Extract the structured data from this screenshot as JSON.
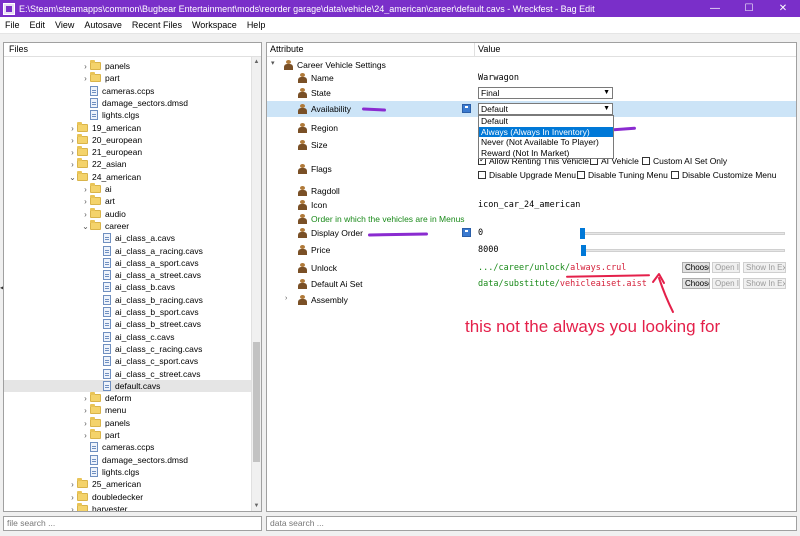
{
  "window": {
    "title": "E:\\Steam\\steamapps\\common\\Bugbear Entertainment\\mods\\reorder garage\\data\\vehicle\\24_american\\career\\default.cavs - Wreckfest - Bag Edit",
    "minimize": "—",
    "maximize": "☐",
    "close": "✕"
  },
  "menu": [
    "File",
    "Edit",
    "View",
    "Autosave",
    "Recent Files",
    "Workspace",
    "Help"
  ],
  "files_panel": {
    "header": "Files",
    "tree": [
      {
        "label": "panels",
        "type": "folder",
        "depth": 1,
        "expandable": true
      },
      {
        "label": "part",
        "type": "folder",
        "depth": 1,
        "expandable": true
      },
      {
        "label": "cameras.ccps",
        "type": "file",
        "depth": 1
      },
      {
        "label": "damage_sectors.dmsd",
        "type": "file",
        "depth": 1
      },
      {
        "label": "lights.clgs",
        "type": "file",
        "depth": 1
      },
      {
        "label": "19_american",
        "type": "folder",
        "depth": 0,
        "expandable": true
      },
      {
        "label": "20_european",
        "type": "folder",
        "depth": 0,
        "expandable": true
      },
      {
        "label": "21_european",
        "type": "folder",
        "depth": 0,
        "expandable": true
      },
      {
        "label": "22_asian",
        "type": "folder",
        "depth": 0,
        "expandable": true
      },
      {
        "label": "24_american",
        "type": "folder",
        "depth": 0,
        "expanded": true
      },
      {
        "label": "ai",
        "type": "folder",
        "depth": 1,
        "expandable": true
      },
      {
        "label": "art",
        "type": "folder",
        "depth": 1,
        "expandable": true
      },
      {
        "label": "audio",
        "type": "folder",
        "depth": 1,
        "expandable": true
      },
      {
        "label": "career",
        "type": "folder",
        "depth": 1,
        "expanded": true
      },
      {
        "label": "ai_class_a.cavs",
        "type": "file",
        "depth": 2
      },
      {
        "label": "ai_class_a_racing.cavs",
        "type": "file",
        "depth": 2
      },
      {
        "label": "ai_class_a_sport.cavs",
        "type": "file",
        "depth": 2
      },
      {
        "label": "ai_class_a_street.cavs",
        "type": "file",
        "depth": 2
      },
      {
        "label": "ai_class_b.cavs",
        "type": "file",
        "depth": 2
      },
      {
        "label": "ai_class_b_racing.cavs",
        "type": "file",
        "depth": 2
      },
      {
        "label": "ai_class_b_sport.cavs",
        "type": "file",
        "depth": 2
      },
      {
        "label": "ai_class_b_street.cavs",
        "type": "file",
        "depth": 2
      },
      {
        "label": "ai_class_c.cavs",
        "type": "file",
        "depth": 2
      },
      {
        "label": "ai_class_c_racing.cavs",
        "type": "file",
        "depth": 2
      },
      {
        "label": "ai_class_c_sport.cavs",
        "type": "file",
        "depth": 2
      },
      {
        "label": "ai_class_c_street.cavs",
        "type": "file",
        "depth": 2
      },
      {
        "label": "default.cavs",
        "type": "file",
        "depth": 2,
        "selected": true
      },
      {
        "label": "deform",
        "type": "folder",
        "depth": 1,
        "expandable": true
      },
      {
        "label": "menu",
        "type": "folder",
        "depth": 1,
        "expandable": true
      },
      {
        "label": "panels",
        "type": "folder",
        "depth": 1,
        "expandable": true
      },
      {
        "label": "part",
        "type": "folder",
        "depth": 1,
        "expandable": true
      },
      {
        "label": "cameras.ccps",
        "type": "file",
        "depth": 1
      },
      {
        "label": "damage_sectors.dmsd",
        "type": "file",
        "depth": 1
      },
      {
        "label": "lights.clgs",
        "type": "file",
        "depth": 1
      },
      {
        "label": "25_american",
        "type": "folder",
        "depth": 0,
        "expandable": true
      },
      {
        "label": "doubledecker",
        "type": "folder",
        "depth": 0,
        "expandable": true
      },
      {
        "label": "harvester",
        "type": "folder",
        "depth": 0,
        "expandable": true
      }
    ],
    "search_placeholder": "file search ..."
  },
  "data_panel": {
    "col_attribute": "Attribute",
    "col_value": "Value",
    "root_label": "Career Vehicle Settings",
    "name": {
      "label": "Name",
      "value": "Warwagon"
    },
    "state": {
      "label": "State",
      "value": "Final"
    },
    "availability": {
      "label": "Availability",
      "value": "Default",
      "options": [
        "Default",
        "Always (Always In Inventory)",
        "Never (Not Available To Player)",
        "Reward (Not In Market)"
      ],
      "highlighted": "Always (Always In Inventory)"
    },
    "region": {
      "label": "Region"
    },
    "size": {
      "label": "Size"
    },
    "flags": {
      "label": "Flags",
      "items": [
        {
          "label": "Allow Renting This Vehicle",
          "checked": true
        },
        {
          "label": "AI Vehicle",
          "checked": false
        },
        {
          "label": "Custom AI Set Only",
          "checked": false
        },
        {
          "label": "Disable Upgrade Menu",
          "checked": false
        },
        {
          "label": "Disable Tuning Menu",
          "checked": false
        },
        {
          "label": "Disable Customize Menu",
          "checked": false
        }
      ]
    },
    "ragdoll": {
      "label": "Ragdoll"
    },
    "icon": {
      "label": "Icon",
      "value": "icon_car_24_american"
    },
    "display_order_hint": "Order in which the vehicles are in Menus",
    "display_order": {
      "label": "Display Order",
      "value": "0"
    },
    "price": {
      "label": "Price",
      "value": "8000"
    },
    "unlock": {
      "label": "Unlock",
      "value_prefix": ".../career/unlock/",
      "value_highlight": "always.crul",
      "btn_choose": "Choose",
      "btn_open": "Open In",
      "btn_show": "Show In Explorer"
    },
    "default_ai_set": {
      "label": "Default Ai Set",
      "value_prefix": "data/substitute/",
      "value_highlight": "vehicleaiset.aist",
      "btn_choose": "Choose",
      "btn_open": "Open In",
      "btn_show": "Show In Explorer"
    },
    "assembly": {
      "label": "Assembly"
    },
    "search_placeholder": "data search ..."
  },
  "annotation": {
    "text": "this not the always you looking for",
    "color": "#e4204a"
  },
  "colors": {
    "titlebar": "#7a2fc9",
    "selection": "#0078d7",
    "scribble": "#8a2bd0"
  }
}
